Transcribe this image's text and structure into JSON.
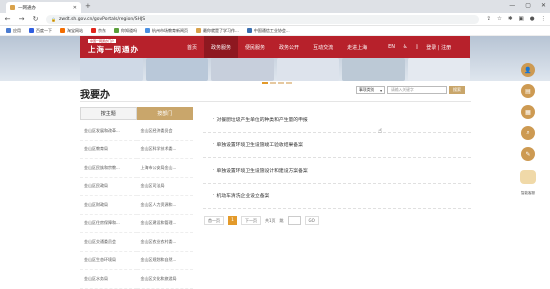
{
  "browser": {
    "tab_title": "一网通办",
    "url": "zwdt.sh.gov.cn/govPortals/region/SHJS",
    "bookmarks": [
      {
        "label": "应用",
        "color": "#4a7bd0"
      },
      {
        "label": "百度一下",
        "color": "#2f5ee0"
      },
      {
        "label": "淘宝网站",
        "color": "#f36d00"
      },
      {
        "label": "京东",
        "color": "#e1251b"
      },
      {
        "label": "你知道吗",
        "color": "#5a9f3a"
      },
      {
        "label": "杭州市场教育新闻页",
        "color": "#4a90e2"
      },
      {
        "label": "最你就是了学习作...",
        "color": "#d9a24b"
      },
      {
        "label": "中国通信工业协会...",
        "color": "#3a6fb0"
      }
    ]
  },
  "header": {
    "logo_text": "上海一网通办",
    "logo_sub": "中国一网通办门户",
    "nav": [
      {
        "label": "首页"
      },
      {
        "label": "政务服务"
      },
      {
        "label": "便民服务"
      },
      {
        "label": "政务公开"
      },
      {
        "label": "互动交流"
      },
      {
        "label": "走进上海"
      }
    ],
    "lang": "EN",
    "login": "登录 | 注册"
  },
  "colors": {
    "brand_red": "#b7212b",
    "gold": "#c9a66b",
    "orange": "#e39a2a"
  },
  "section": {
    "title": "我要办",
    "search_select": "事项类别",
    "search_placeholder": "请输入关键字",
    "search_button": "搜索"
  },
  "left_tabs": [
    "按主题",
    "按部门"
  ],
  "departments": [
    "金山区发展和改革...",
    "金山区经济委员会",
    "金山区教育局",
    "金山区科学技术委...",
    "金山区民族和宗教...",
    "上海市公安局金山...",
    "金山区民政局",
    "金山区司法局",
    "金山区财政局",
    "金山区人力资源和...",
    "金山区住房保障和...",
    "金山区建设和管理...",
    "金山区交通委员会",
    "金山区农业农村委...",
    "金山区生态环境局",
    "金山区规划和自然...",
    "金山区水务局",
    "金山区文化和旅游局"
  ],
  "services": [
    "对餐厨垃圾产生单位的种类和产生量的申报",
    "单独设置环境卫生设施竣工验收结果备案",
    "单独设置环境卫生设施设计和建设方案备案",
    "机动车清洗企业设立备案"
  ],
  "pager": {
    "first": "首一页",
    "current": "1",
    "next": "下一页",
    "total": "共1页",
    "goto": "跳",
    "go": "GO"
  },
  "right_float": {
    "robot_label": "智能客服"
  }
}
